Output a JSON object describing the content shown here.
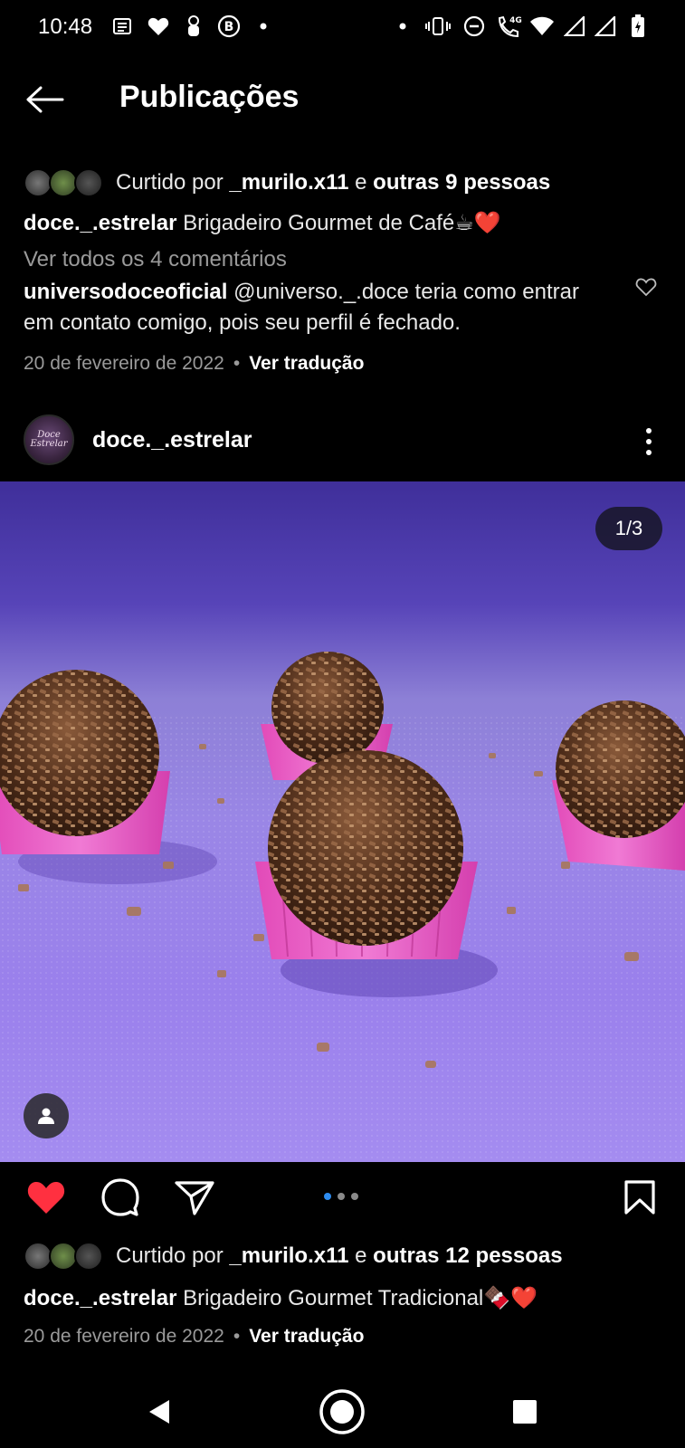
{
  "status_bar": {
    "time": "10:48",
    "left_icons": [
      "notes-icon",
      "heart-icon",
      "baby-icon",
      "b-letter-icon",
      "dot-icon"
    ],
    "right_icons": [
      "dot-icon",
      "vibrate-icon",
      "do-not-disturb-icon",
      "volte-call-icon",
      "wifi-icon",
      "signal-icon",
      "signal-icon",
      "battery-charging-icon"
    ],
    "network_label": "4G"
  },
  "app_bar": {
    "title": "Publicações"
  },
  "previous_post": {
    "likes": {
      "prefix": "Curtido por ",
      "user": "_murilo.x11",
      "connector": " e ",
      "others": "outras 9 pessoas"
    },
    "caption": {
      "user": "doce._.estrelar",
      "text": " Brigadeiro Gourmet de Café☕❤️"
    },
    "view_comments": "Ver todos os 4 comentários",
    "comment": {
      "user": "universodoceoficial",
      "text": " @universo._.doce teria como entrar em contato comigo, pois seu perfil é fechado."
    },
    "date": "20 de fevereiro de 2022",
    "separator": "•",
    "translate": "Ver tradução"
  },
  "post": {
    "username": "doce._.estrelar",
    "avatar_text": "Doce Estrelar",
    "media_counter": "1/3",
    "carousel": {
      "count": 3,
      "active": 1
    },
    "likes": {
      "prefix": "Curtido por ",
      "user": "_murilo.x11",
      "connector": " e ",
      "others": "outras 12 pessoas"
    },
    "caption": {
      "user": "doce._.estrelar",
      "text": " Brigadeiro Gourmet Tradicional🍫❤️"
    },
    "date": "20 de fevereiro de 2022",
    "separator": "•",
    "translate": "Ver tradução",
    "liked": true
  },
  "colors": {
    "background": "#000000",
    "like_red": "#ff3040",
    "carousel_active": "#2d8cf0",
    "photo_purple": "#8e78e0"
  }
}
